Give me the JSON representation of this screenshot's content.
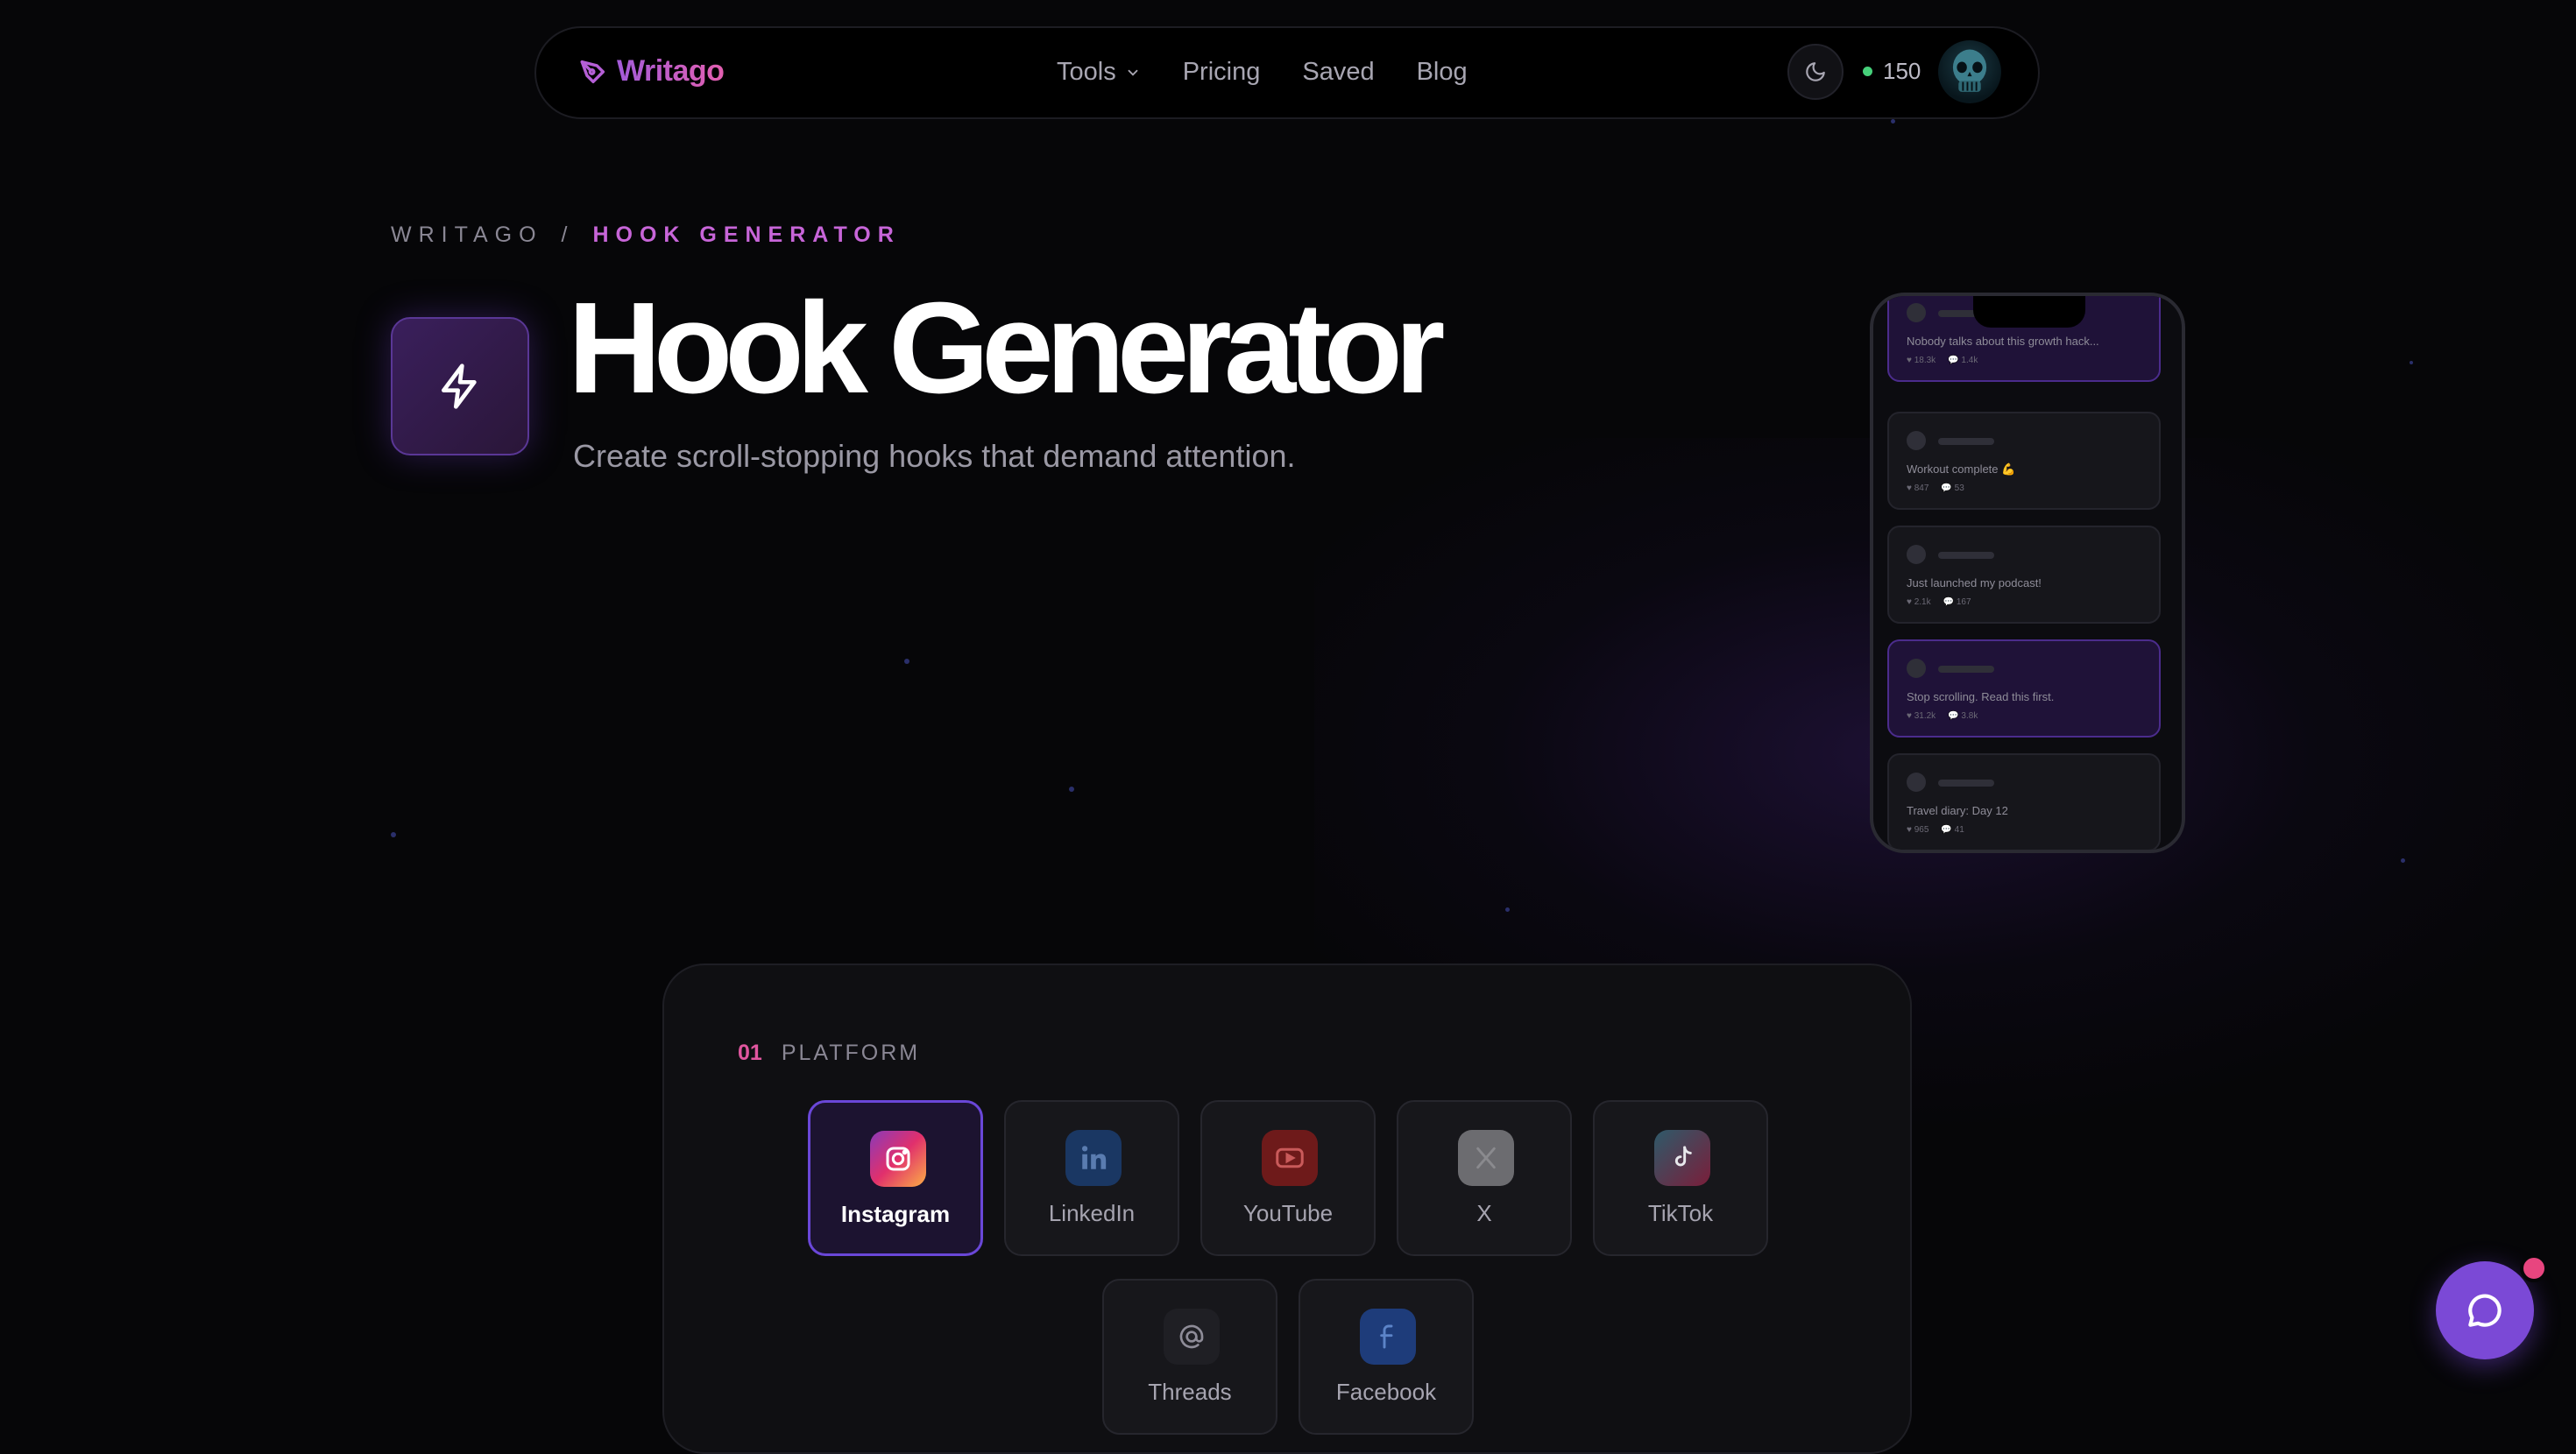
{
  "nav": {
    "logo_text": "Writago",
    "links": [
      "Tools",
      "Pricing",
      "Saved",
      "Blog"
    ],
    "credits": "150"
  },
  "breadcrumb": {
    "root": "WRITAGO",
    "separator": "/",
    "current": "HOOK GENERATOR"
  },
  "hero": {
    "title": "Hook Generator",
    "subtitle": "Create scroll-stopping hooks that demand attention."
  },
  "phone_posts": [
    {
      "text": "Nobody talks about this growth hack...",
      "likes": "18.3k",
      "comments": "1.4k",
      "highlight": true
    },
    {
      "text": "Workout complete 💪",
      "likes": "847",
      "comments": "53",
      "highlight": false
    },
    {
      "text": "Just launched my podcast!",
      "likes": "2.1k",
      "comments": "167",
      "highlight": false
    },
    {
      "text": "Stop scrolling. Read this first.",
      "likes": "31.2k",
      "comments": "3.8k",
      "highlight": true
    },
    {
      "text": "Travel diary: Day 12",
      "likes": "965",
      "comments": "41",
      "highlight": false
    }
  ],
  "platform_section": {
    "number": "01",
    "label": "PLATFORM",
    "options": [
      {
        "name": "Instagram",
        "icon": "instagram-icon",
        "color": "#e1306c",
        "selected": true
      },
      {
        "name": "LinkedIn",
        "icon": "linkedin-icon",
        "color": "#0a66c2",
        "selected": false
      },
      {
        "name": "YouTube",
        "icon": "youtube-icon",
        "color": "#ff0000",
        "selected": false
      },
      {
        "name": "X",
        "icon": "x-icon",
        "color": "#ffffff",
        "selected": false
      },
      {
        "name": "TikTok",
        "icon": "tiktok-icon",
        "color": "#fe2c55",
        "selected": false
      },
      {
        "name": "Threads",
        "icon": "threads-icon",
        "color": "#333333",
        "selected": false
      },
      {
        "name": "Facebook",
        "icon": "facebook-icon",
        "color": "#1877f2",
        "selected": false
      }
    ]
  },
  "colors": {
    "accent": "#7b49d6",
    "brand_pink": "#e0569f",
    "background": "#060608"
  }
}
